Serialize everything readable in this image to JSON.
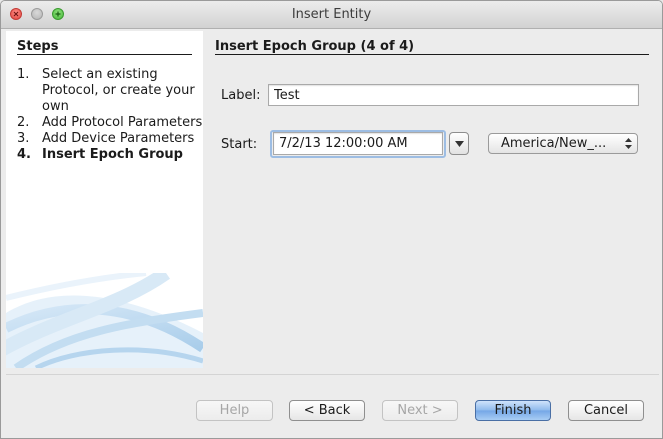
{
  "window": {
    "title": "Insert Entity"
  },
  "steps": {
    "title": "Steps",
    "items": [
      {
        "num": "1.",
        "label": "Select an existing Protocol, or create your own",
        "current": false
      },
      {
        "num": "2.",
        "label": "Add Protocol Parameters",
        "current": false
      },
      {
        "num": "3.",
        "label": "Add Device Parameters",
        "current": false
      },
      {
        "num": "4.",
        "label": "Insert Epoch Group",
        "current": true
      }
    ]
  },
  "content": {
    "title": "Insert Epoch Group (4 of 4)",
    "label_field": {
      "label": "Label:",
      "value": "Test"
    },
    "start_field": {
      "label": "Start:",
      "value": "7/2/13 12:00:00 AM",
      "dropdown_icon": "triangle-down-icon"
    },
    "timezone": {
      "selected": "America/New_..."
    }
  },
  "buttons": {
    "help": "Help",
    "back": "< Back",
    "next": "Next >",
    "finish": "Finish",
    "cancel": "Cancel"
  },
  "colors": {
    "default_button": "#74a6e6",
    "focus_ring": "#9dbde3",
    "close_light": "#e0443e",
    "max_light": "#47b83a"
  }
}
